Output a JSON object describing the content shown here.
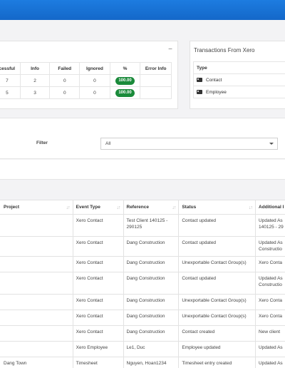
{
  "stats_panel": {
    "collapse_symbol": "−",
    "headers": [
      "cessful",
      "Info",
      "Failed",
      "Ignored",
      "%",
      "Error Info"
    ],
    "rows": [
      {
        "successful": "7",
        "info": "2",
        "failed": "0",
        "ignored": "0",
        "percent": "100.00",
        "error_info": ""
      },
      {
        "successful": "5",
        "info": "3",
        "failed": "0",
        "ignored": "0",
        "percent": "100.00",
        "error_info": ""
      }
    ],
    "percent_badge_color": "#1a8a3a"
  },
  "transactions_panel": {
    "title": "Transactions From Xero",
    "header_type": "Type",
    "rows": [
      {
        "icon": "id-card-icon",
        "type": "Contact"
      },
      {
        "icon": "id-card-icon",
        "type": "Employee"
      }
    ]
  },
  "filter": {
    "label": "Filter",
    "selected": "All"
  },
  "log_table": {
    "headers": {
      "project": "Project",
      "event_type": "Event Type",
      "reference": "Reference",
      "status": "Status",
      "additional": "Additional I"
    },
    "rows": [
      {
        "project": "",
        "event_type": "Xero Contact",
        "reference": "Test Client 140125 - 290125",
        "status": "Contact updated",
        "additional": "Updated As 140125 - 29"
      },
      {
        "project": "",
        "event_type": "Xero Contact",
        "reference": "Dang Construction",
        "status": "Contact updated",
        "additional": "Updated As Constructio"
      },
      {
        "project": "",
        "event_type": "Xero Contact",
        "reference": "Dang Construction",
        "status": "Unexportable Contact Group(s)",
        "additional": "Xero Conta"
      },
      {
        "project": "",
        "event_type": "Xero Contact",
        "reference": "Dang Construction",
        "status": "Contact updated",
        "additional": "Updated As Constructio"
      },
      {
        "project": "",
        "event_type": "Xero Contact",
        "reference": "Dang Construction",
        "status": "Unexportable Contact Group(s)",
        "additional": "Xero Conta"
      },
      {
        "project": "",
        "event_type": "Xero Contact",
        "reference": "Dang Construction",
        "status": "Unexportable Contact Group(s)",
        "additional": "Xero Conta"
      },
      {
        "project": "",
        "event_type": "Xero Contact",
        "reference": "Dang Construction",
        "status": "Contact created",
        "additional": "New client"
      },
      {
        "project": "",
        "event_type": "Xero Employee",
        "reference": "Le1, Duc",
        "status": "Employee updated",
        "additional": "Updated As"
      },
      {
        "project": "Dang Town",
        "event_type": "Timesheet",
        "reference": "Nguyen, Hoan1234",
        "status": "Timesheet entry created",
        "additional": "Updated As"
      }
    ]
  },
  "colors": {
    "topbar": "#1468c9",
    "badge": "#1a8a3a"
  }
}
